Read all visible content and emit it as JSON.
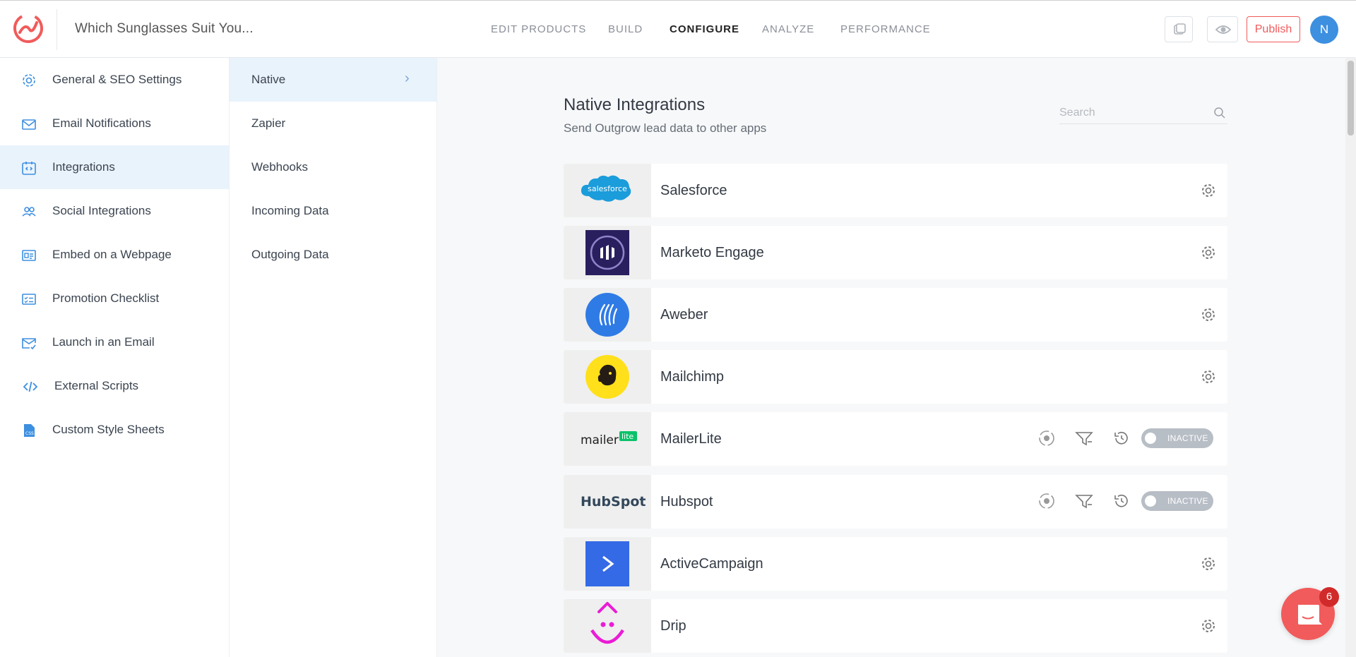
{
  "header": {
    "app_title": "Which Sunglasses Suit You...",
    "nav": [
      "EDIT PRODUCTS",
      "BUILD",
      "CONFIGURE",
      "ANALYZE",
      "PERFORMANCE"
    ],
    "active_nav": "CONFIGURE",
    "publish_label": "Publish",
    "avatar_initial": "N"
  },
  "sidebar": {
    "items": [
      {
        "label": "General & SEO Settings",
        "icon": "gear-icon"
      },
      {
        "label": "Email Notifications",
        "icon": "envelope-icon"
      },
      {
        "label": "Integrations",
        "icon": "integrations-icon"
      },
      {
        "label": "Social Integrations",
        "icon": "users-icon"
      },
      {
        "label": "Embed on a Webpage",
        "icon": "embed-icon"
      },
      {
        "label": "Promotion Checklist",
        "icon": "checklist-icon"
      },
      {
        "label": "Launch in an Email",
        "icon": "email-launch-icon"
      },
      {
        "label": "External Scripts",
        "icon": "code-icon"
      },
      {
        "label": "Custom Style Sheets",
        "icon": "css-file-icon"
      }
    ],
    "active": "Integrations"
  },
  "subbar": {
    "items": [
      "Native",
      "Zapier",
      "Webhooks",
      "Incoming Data",
      "Outgoing Data"
    ],
    "active": "Native"
  },
  "main": {
    "title": "Native Integrations",
    "subtitle": "Send Outgrow lead data to other apps",
    "search_placeholder": "Search",
    "integrations": [
      {
        "name": "Salesforce",
        "logo_text": "salesforce",
        "type": "gear"
      },
      {
        "name": "Marketo Engage",
        "type": "gear"
      },
      {
        "name": "Aweber",
        "type": "gear"
      },
      {
        "name": "Mailchimp",
        "type": "gear"
      },
      {
        "name": "MailerLite",
        "logo_text": "mailer",
        "logo_badge": "lite",
        "type": "toggle",
        "status": "INACTIVE"
      },
      {
        "name": "Hubspot",
        "logo_text": "HubSpot",
        "type": "toggle",
        "status": "INACTIVE"
      },
      {
        "name": "ActiveCampaign",
        "type": "gear"
      },
      {
        "name": "Drip",
        "type": "gear"
      }
    ]
  },
  "chat": {
    "badge_count": "6"
  },
  "colors": {
    "accent": "#f15b5b",
    "active_bg": "#e9f3fc",
    "icon_blue": "#3d8fe0",
    "toggle_inactive": "#b8bec6"
  }
}
